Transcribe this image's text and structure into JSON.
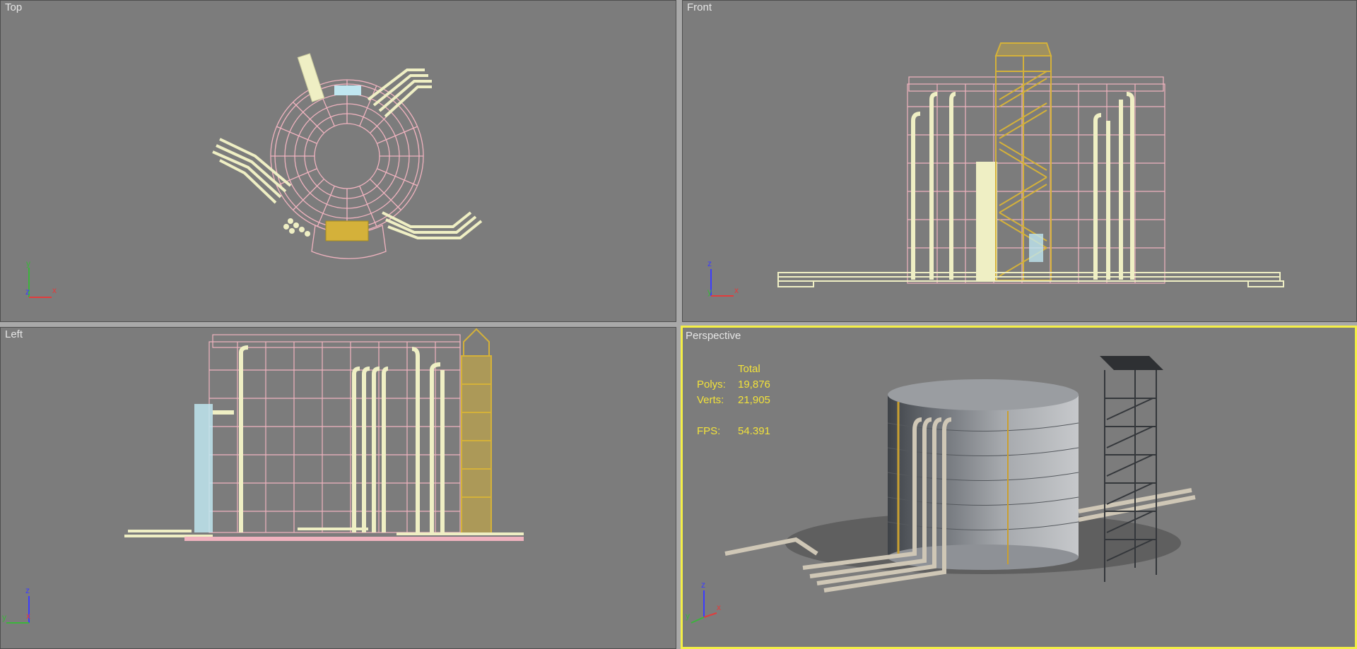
{
  "viewports": {
    "top": {
      "label": "Top"
    },
    "front": {
      "label": "Front"
    },
    "left": {
      "label": "Left"
    },
    "perspective": {
      "label": "Perspective"
    }
  },
  "stats": {
    "header": "Total",
    "polys_label": "Polys:",
    "polys_value": "19,876",
    "verts_label": "Verts:",
    "verts_value": "21,905",
    "fps_label": "FPS:",
    "fps_value": "54.391"
  },
  "axes": {
    "top": [
      "y",
      "z",
      "x"
    ],
    "front": [
      "z",
      "y",
      "x"
    ],
    "left": [
      "z",
      "y",
      "x"
    ],
    "perspective": [
      "z",
      "y",
      "x"
    ]
  },
  "colors": {
    "viewport_bg": "#7c7c7c",
    "active_border": "#f4ef46",
    "tank_wire": "#f0b3bf",
    "pipe": "#efefc4",
    "stair": "#d4b13a",
    "accent_blue": "#bfe6f0",
    "stats_text": "#f2e23a"
  }
}
